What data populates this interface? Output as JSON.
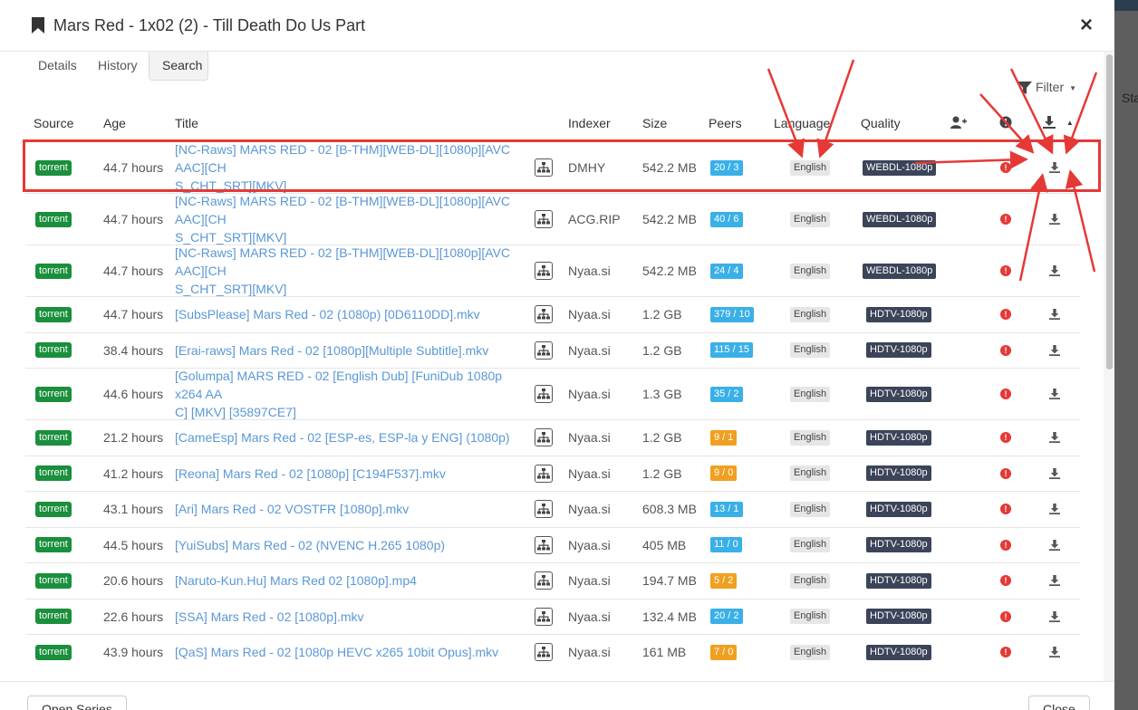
{
  "modal": {
    "title": "Mars Red - 1x02 (2) - Till Death Do Us Part",
    "close_symbol": "×",
    "background_partial_text": "Sta"
  },
  "tabs": [
    {
      "label": "Details",
      "active": false
    },
    {
      "label": "History",
      "active": false
    },
    {
      "label": "Search",
      "active": true
    }
  ],
  "filter": {
    "label": "Filter",
    "icon": "filter-icon"
  },
  "columns": {
    "source": "Source",
    "age": "Age",
    "title": "Title",
    "indexer": "Indexer",
    "size": "Size",
    "peers": "Peers",
    "language": "Language",
    "quality": "Quality",
    "add_user_icon": "user-plus-icon",
    "rejection_icon": "alert-circle-icon",
    "download_icon": "download-icon"
  },
  "colors": {
    "accent_link": "#5a98d6",
    "torrent_badge": "#1a8f3c",
    "peers_good": "#3ab0e8",
    "peers_low": "#f0a020",
    "quality_badge": "#3b4459",
    "error": "#e53935",
    "annotation": "#e53935"
  },
  "rows": [
    {
      "source": "torrent",
      "age": "44.7 hours",
      "title_l1": "[NC-Raws] MARS RED - 02 [B-THM][WEB-DL][1080p][AVC AAC][CH",
      "title_l2": "S_CHT_SRT][MKV]",
      "indexer": "DMHY",
      "size": "542.2 MB",
      "peers": "20 / 3",
      "peers_status": "good",
      "language": "English",
      "quality": "WEBDL-1080p"
    },
    {
      "source": "torrent",
      "age": "44.7 hours",
      "title_l1": "[NC-Raws] MARS RED - 02 [B-THM][WEB-DL][1080p][AVC AAC][CH",
      "title_l2": "S_CHT_SRT][MKV]",
      "indexer": "ACG.RIP",
      "size": "542.2 MB",
      "peers": "40 / 6",
      "peers_status": "good",
      "language": "English",
      "quality": "WEBDL-1080p"
    },
    {
      "source": "torrent",
      "age": "44.7 hours",
      "title_l1": "[NC-Raws] MARS RED - 02 [B-THM][WEB-DL][1080p][AVC AAC][CH",
      "title_l2": "S_CHT_SRT][MKV]",
      "indexer": "Nyaa.si",
      "size": "542.2 MB",
      "peers": "24 / 4",
      "peers_status": "good",
      "language": "English",
      "quality": "WEBDL-1080p"
    },
    {
      "source": "torrent",
      "age": "44.7 hours",
      "title_l1": "[SubsPlease] Mars Red - 02 (1080p) [0D6110DD].mkv",
      "title_l2": "",
      "indexer": "Nyaa.si",
      "size": "1.2 GB",
      "peers": "379 / 10",
      "peers_status": "good",
      "language": "English",
      "quality": "HDTV-1080p"
    },
    {
      "source": "torrent",
      "age": "38.4 hours",
      "title_l1": "[Erai-raws] Mars Red - 02 [1080p][Multiple Subtitle].mkv",
      "title_l2": "",
      "indexer": "Nyaa.si",
      "size": "1.2 GB",
      "peers": "115 / 15",
      "peers_status": "good",
      "language": "English",
      "quality": "HDTV-1080p"
    },
    {
      "source": "torrent",
      "age": "44.6 hours",
      "title_l1": "[Golumpa] MARS RED - 02 [English Dub] [FuniDub 1080p x264 AA",
      "title_l2": "C] [MKV] [35897CE7]",
      "indexer": "Nyaa.si",
      "size": "1.3 GB",
      "peers": "35 / 2",
      "peers_status": "good",
      "language": "English",
      "quality": "HDTV-1080p"
    },
    {
      "source": "torrent",
      "age": "21.2 hours",
      "title_l1": "[CameEsp] Mars Red - 02 [ESP-es, ESP-la y ENG] (1080p)",
      "title_l2": "",
      "indexer": "Nyaa.si",
      "size": "1.2 GB",
      "peers": "9 / 1",
      "peers_status": "low",
      "language": "English",
      "quality": "HDTV-1080p"
    },
    {
      "source": "torrent",
      "age": "41.2 hours",
      "title_l1": "[Reona] Mars Red - 02 [1080p] [C194F537].mkv",
      "title_l2": "",
      "indexer": "Nyaa.si",
      "size": "1.2 GB",
      "peers": "9 / 0",
      "peers_status": "low",
      "language": "English",
      "quality": "HDTV-1080p"
    },
    {
      "source": "torrent",
      "age": "43.1 hours",
      "title_l1": "[Ari] Mars Red - 02 VOSTFR [1080p].mkv",
      "title_l2": "",
      "indexer": "Nyaa.si",
      "size": "608.3 MB",
      "peers": "13 / 1",
      "peers_status": "good",
      "language": "English",
      "quality": "HDTV-1080p"
    },
    {
      "source": "torrent",
      "age": "44.5 hours",
      "title_l1": "[YuiSubs] Mars Red - 02 (NVENC H.265 1080p)",
      "title_l2": "",
      "indexer": "Nyaa.si",
      "size": "405 MB",
      "peers": "11 / 0",
      "peers_status": "good",
      "language": "English",
      "quality": "HDTV-1080p"
    },
    {
      "source": "torrent",
      "age": "20.6 hours",
      "title_l1": "[Naruto-Kun.Hu] Mars Red 02 [1080p].mp4",
      "title_l2": "",
      "indexer": "Nyaa.si",
      "size": "194.7 MB",
      "peers": "5 / 2",
      "peers_status": "low",
      "language": "English",
      "quality": "HDTV-1080p"
    },
    {
      "source": "torrent",
      "age": "22.6 hours",
      "title_l1": "[SSA] Mars Red - 02 [1080p].mkv",
      "title_l2": "",
      "indexer": "Nyaa.si",
      "size": "132.4 MB",
      "peers": "20 / 2",
      "peers_status": "good",
      "language": "English",
      "quality": "HDTV-1080p"
    },
    {
      "source": "torrent",
      "age": "43.9 hours",
      "title_l1": "[QaS] Mars Red - 02 [1080p HEVC x265 10bit Opus].mkv",
      "title_l2": "",
      "indexer": "Nyaa.si",
      "size": "161 MB",
      "peers": "7 / 0",
      "peers_status": "low",
      "language": "English",
      "quality": "HDTV-1080p"
    }
  ],
  "footer": {
    "open_series": "Open Series",
    "close": "Close"
  }
}
